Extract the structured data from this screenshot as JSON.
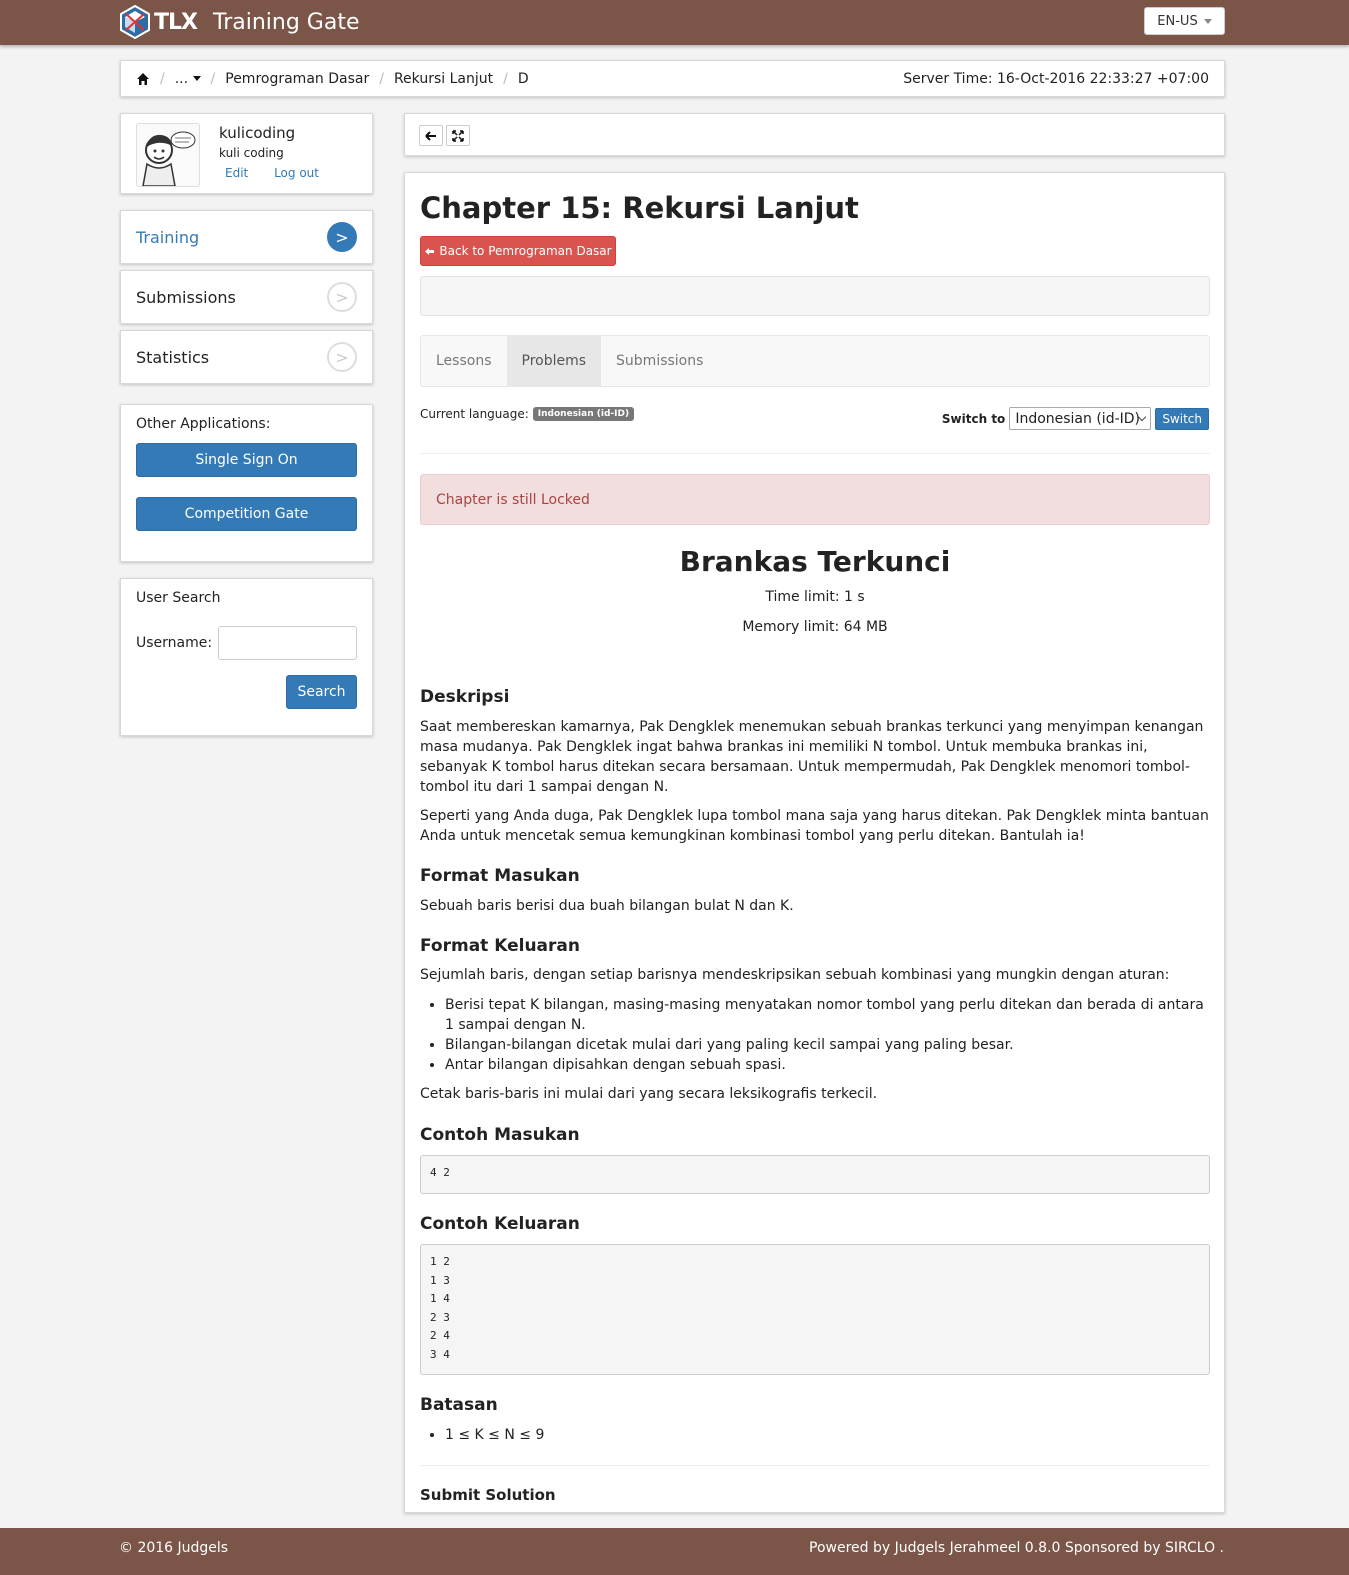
{
  "app": {
    "brand": "TLX",
    "title": "Training Gate",
    "language": "EN-US"
  },
  "breadcrumb": {
    "items": [
      "...",
      "Pemrograman Dasar",
      "Rekursi Lanjut",
      "D"
    ],
    "server_time": "Server Time: 16-Oct-2016 22:33:27 +07:00"
  },
  "profile": {
    "username": "kulicoding",
    "fullname": "kuli coding",
    "edit": "Edit",
    "logout": "Log out"
  },
  "sidebar": {
    "nav": [
      {
        "label": "Training",
        "arrow": ">"
      },
      {
        "label": "Submissions",
        "arrow": ">"
      },
      {
        "label": "Statistics",
        "arrow": ">"
      }
    ],
    "other_apps": {
      "title": "Other Applications:",
      "sso": "Single Sign On",
      "competition": "Competition Gate"
    },
    "user_search": {
      "title": "User Search",
      "username_label": "Username:",
      "username_value": "",
      "search": "Search"
    }
  },
  "chapter": {
    "title": "Chapter 15: Rekursi Lanjut",
    "back": "Back to Pemrograman Dasar"
  },
  "tabs": [
    "Lessons",
    "Problems",
    "Submissions"
  ],
  "language": {
    "current_label": "Current language:",
    "current": "Indonesian (id-ID)",
    "switch_label": "Switch to",
    "selected": "Indonesian (id-ID)",
    "switch_btn": "Switch"
  },
  "alert": "Chapter is still Locked",
  "problem": {
    "title": "Brankas Terkunci",
    "time_limit": "Time limit: 1 s",
    "memory_limit": "Memory limit: 64 MB",
    "deskripsi_h": "Deskripsi",
    "deskripsi_1": "Saat membereskan kamarnya, Pak Dengklek menemukan sebuah brankas terkunci yang menyimpan kenangan masa mudanya. Pak Dengklek ingat bahwa brankas ini memiliki N tombol. Untuk membuka brankas ini, sebanyak K tombol harus ditekan secara bersamaan. Untuk mempermudah, Pak Dengklek menomori tombol-tombol itu dari 1 sampai dengan N.",
    "deskripsi_2": "Seperti yang Anda duga, Pak Dengklek lupa tombol mana saja yang harus ditekan. Pak Dengklek minta bantuan Anda untuk mencetak semua kemungkinan kombinasi tombol yang perlu ditekan. Bantulah ia!",
    "masukan_h": "Format Masukan",
    "masukan": "Sebuah baris berisi dua buah bilangan bulat N dan K.",
    "keluaran_h": "Format Keluaran",
    "keluaran_intro": "Sejumlah baris, dengan setiap barisnya mendeskripsikan sebuah kombinasi yang mungkin dengan aturan:",
    "keluaran_rules": [
      "Berisi tepat K bilangan, masing-masing menyatakan nomor tombol yang perlu ditekan dan berada di antara 1 sampai dengan N.",
      "Bilangan-bilangan dicetak mulai dari yang paling kecil sampai yang paling besar.",
      "Antar bilangan dipisahkan dengan sebuah spasi."
    ],
    "keluaran_outro": "Cetak baris-baris ini mulai dari yang secara leksikografis terkecil.",
    "contoh_masukan_h": "Contoh Masukan",
    "contoh_masukan": "4 2",
    "contoh_keluaran_h": "Contoh Keluaran",
    "contoh_keluaran": "1 2\n1 3\n1 4\n2 3\n2 4\n3 4",
    "batasan_h": "Batasan",
    "batasan": "1 ≤ K ≤ N ≤ 9",
    "submit_h": "Submit Solution"
  },
  "footer": {
    "left": "© 2016 Judgels",
    "right": "Powered by Judgels Jerahmeel 0.8.0 Sponsored by SIRCLO ."
  }
}
